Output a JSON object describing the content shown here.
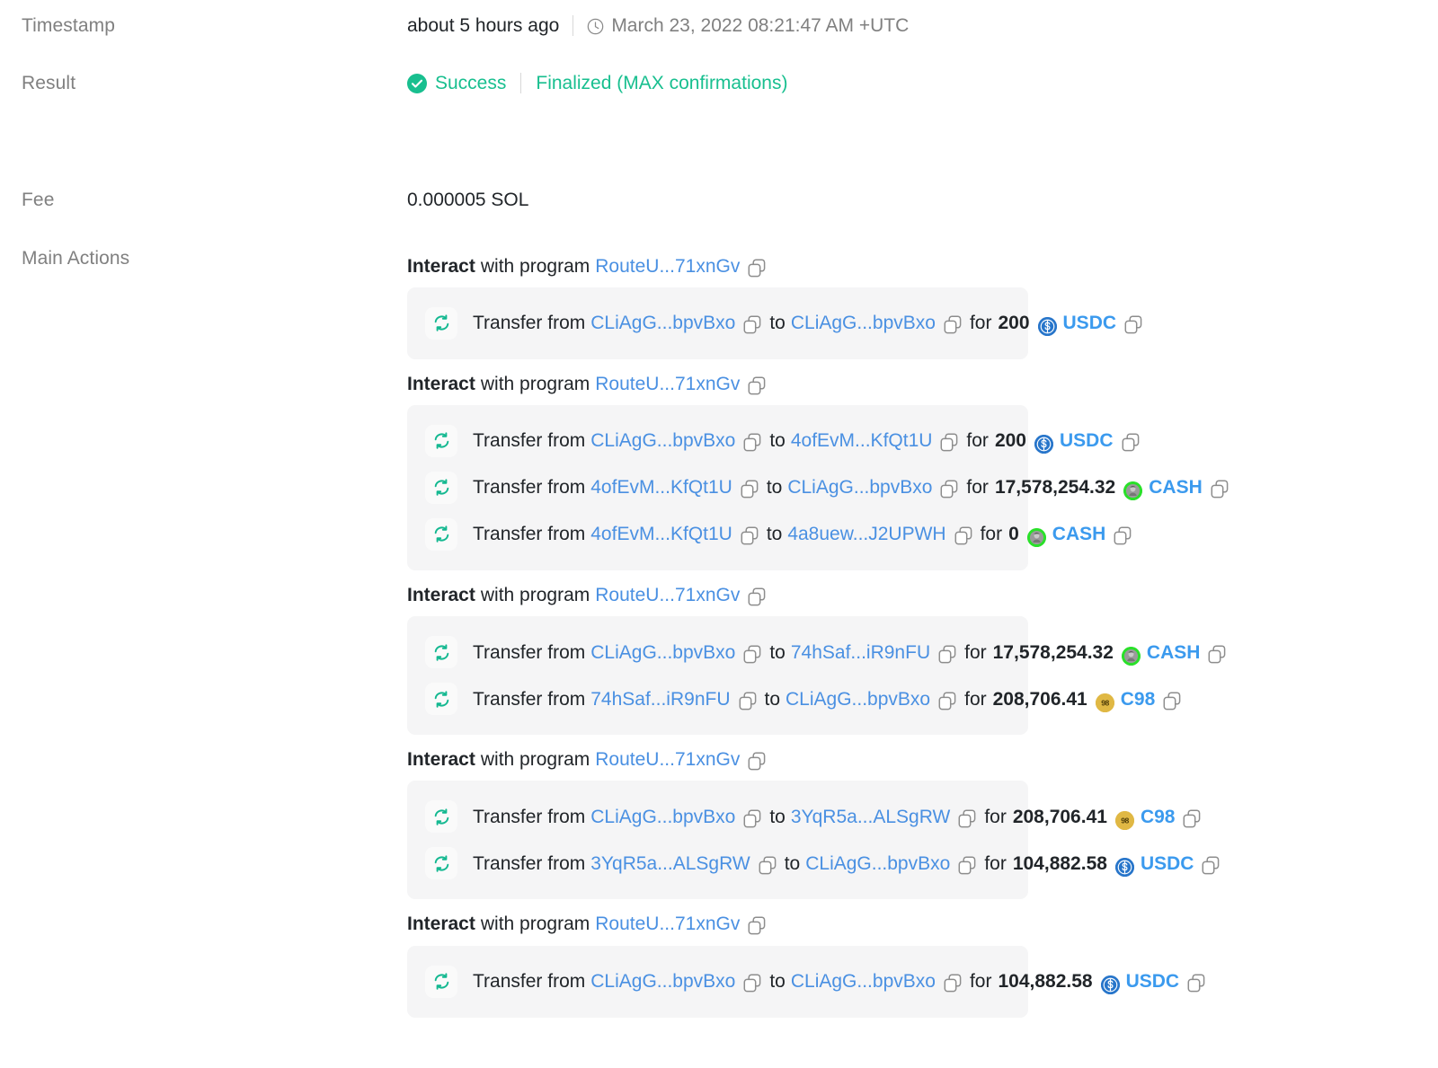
{
  "labels": {
    "timestamp": "Timestamp",
    "result": "Result",
    "fee": "Fee",
    "main_actions": "Main Actions"
  },
  "timestamp": {
    "relative": "about 5 hours ago",
    "absolute": "March 23, 2022 08:21:47 AM +UTC",
    "icon": "clock-icon"
  },
  "result": {
    "status": "Success",
    "status_icon": "check-circle-icon",
    "confirmation": "Finalized (MAX confirmations)",
    "color": "#18bf8f"
  },
  "fee": {
    "value": "0.000005 SOL"
  },
  "words": {
    "interact": "Interact",
    "with_program": "with program",
    "transfer_from": "Transfer from",
    "to": "to",
    "for": "for",
    "copy_icon": "copy-icon",
    "swap_icon": "swap-icon"
  },
  "colors": {
    "link": "#4a90e2",
    "token_link": "#3b9aee",
    "success": "#18bf8f",
    "block_bg": "#f5f5f6",
    "label_gray": "#808080",
    "usdc": "#2775ca",
    "cash": "#2ae02a",
    "c98": "#e0b844"
  },
  "tokens": {
    "usdc": {
      "symbol": "USDC",
      "icon": "usdc-token-icon"
    },
    "cash": {
      "symbol": "CASH",
      "icon": "cash-token-icon"
    },
    "c98": {
      "symbol": "C98",
      "icon": "c98-token-icon"
    }
  },
  "main_actions": [
    {
      "program": "RouteU...71xnGv",
      "transfers": [
        {
          "from": "CLiAgG...bpvBxo",
          "to": "CLiAgG...bpvBxo",
          "amount": "200",
          "token": "USDC",
          "token_key": "usdc"
        }
      ]
    },
    {
      "program": "RouteU...71xnGv",
      "transfers": [
        {
          "from": "CLiAgG...bpvBxo",
          "to": "4ofEvM...KfQt1U",
          "amount": "200",
          "token": "USDC",
          "token_key": "usdc"
        },
        {
          "from": "4ofEvM...KfQt1U",
          "to": "CLiAgG...bpvBxo",
          "amount": "17,578,254.32",
          "token": "CASH",
          "token_key": "cash"
        },
        {
          "from": "4ofEvM...KfQt1U",
          "to": "4a8uew...J2UPWH",
          "amount": "0",
          "token": "CASH",
          "token_key": "cash"
        }
      ]
    },
    {
      "program": "RouteU...71xnGv",
      "transfers": [
        {
          "from": "CLiAgG...bpvBxo",
          "to": "74hSaf...iR9nFU",
          "amount": "17,578,254.32",
          "token": "CASH",
          "token_key": "cash"
        },
        {
          "from": "74hSaf...iR9nFU",
          "to": "CLiAgG...bpvBxo",
          "amount": "208,706.41",
          "token": "C98",
          "token_key": "c98"
        }
      ]
    },
    {
      "program": "RouteU...71xnGv",
      "transfers": [
        {
          "from": "CLiAgG...bpvBxo",
          "to": "3YqR5a...ALSgRW",
          "amount": "208,706.41",
          "token": "C98",
          "token_key": "c98"
        },
        {
          "from": "3YqR5a...ALSgRW",
          "to": "CLiAgG...bpvBxo",
          "amount": "104,882.58",
          "token": "USDC",
          "token_key": "usdc"
        }
      ]
    },
    {
      "program": "RouteU...71xnGv",
      "transfers": [
        {
          "from": "CLiAgG...bpvBxo",
          "to": "CLiAgG...bpvBxo",
          "amount": "104,882.58",
          "token": "USDC",
          "token_key": "usdc"
        }
      ]
    }
  ]
}
